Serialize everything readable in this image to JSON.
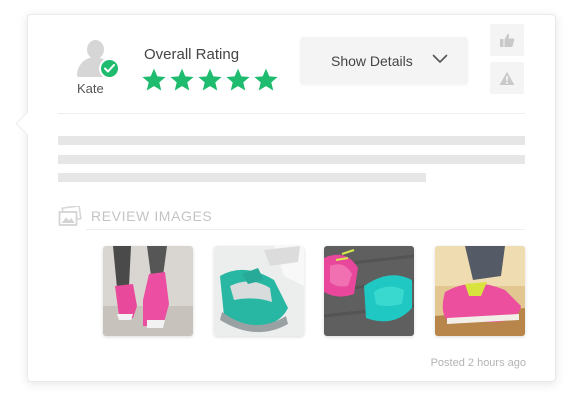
{
  "review": {
    "user_name": "Kate",
    "rating_label": "Overall Rating",
    "rating": 5,
    "rating_max": 5,
    "show_details_label": "Show Details",
    "images_heading": "REVIEW IMAGES",
    "posted_time": "Posted 2 hours ago"
  },
  "icons": {
    "avatar": "user-silhouette-icon",
    "verified": "check-circle-icon",
    "star": "star-icon",
    "chevron": "chevron-down-icon",
    "like": "thumbs-up-icon",
    "report": "warning-icon",
    "images": "image-gallery-icon"
  },
  "colors": {
    "star": "#1fbc6f",
    "verified_badge": "#1fbc6f",
    "placeholder_text": "#e6e6e6",
    "muted_text": "#c4c4c4"
  },
  "images": [
    {
      "name": "pink-sneakers-running"
    },
    {
      "name": "teal-sneakers-closeup"
    },
    {
      "name": "pink-and-teal-sneakers-on-wood"
    },
    {
      "name": "pink-sneaker-autumn"
    }
  ]
}
